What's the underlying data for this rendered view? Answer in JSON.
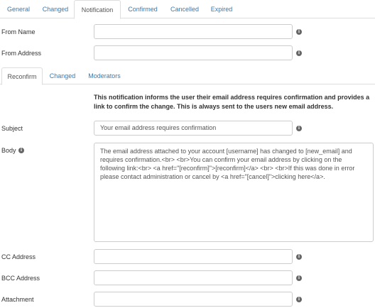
{
  "top_tabs": [
    {
      "label": "General"
    },
    {
      "label": "Changed"
    },
    {
      "label": "Notification"
    },
    {
      "label": "Confirmed"
    },
    {
      "label": "Cancelled"
    },
    {
      "label": "Expired"
    }
  ],
  "from_name": {
    "label": "From Name",
    "value": ""
  },
  "from_address": {
    "label": "From Address",
    "value": ""
  },
  "sub_tabs": [
    {
      "label": "Reconfirm"
    },
    {
      "label": "Changed"
    },
    {
      "label": "Moderators"
    }
  ],
  "notice": "This notification informs the user their email address requires confirmation and provides a link to confirm the change. This is always sent to the users new email address.",
  "subject": {
    "label": "Subject",
    "value": "Your email address requires confirmation"
  },
  "body": {
    "label": "Body",
    "value": "The email address attached to your account [username] has changed to [new_email] and requires confirmation.<br> <br>You can confirm your email address by clicking on the following link:<br> <a href=\"[reconfirm]\">[reconfirm]</a> <br> <br>If this was done in error please contact administration or cancel by <a href=\"[cancel]\">clicking here</a>."
  },
  "cc_address": {
    "label": "CC Address",
    "value": ""
  },
  "bcc_address": {
    "label": "BCC Address",
    "value": ""
  },
  "attachment": {
    "label": "Attachment",
    "value": ""
  }
}
